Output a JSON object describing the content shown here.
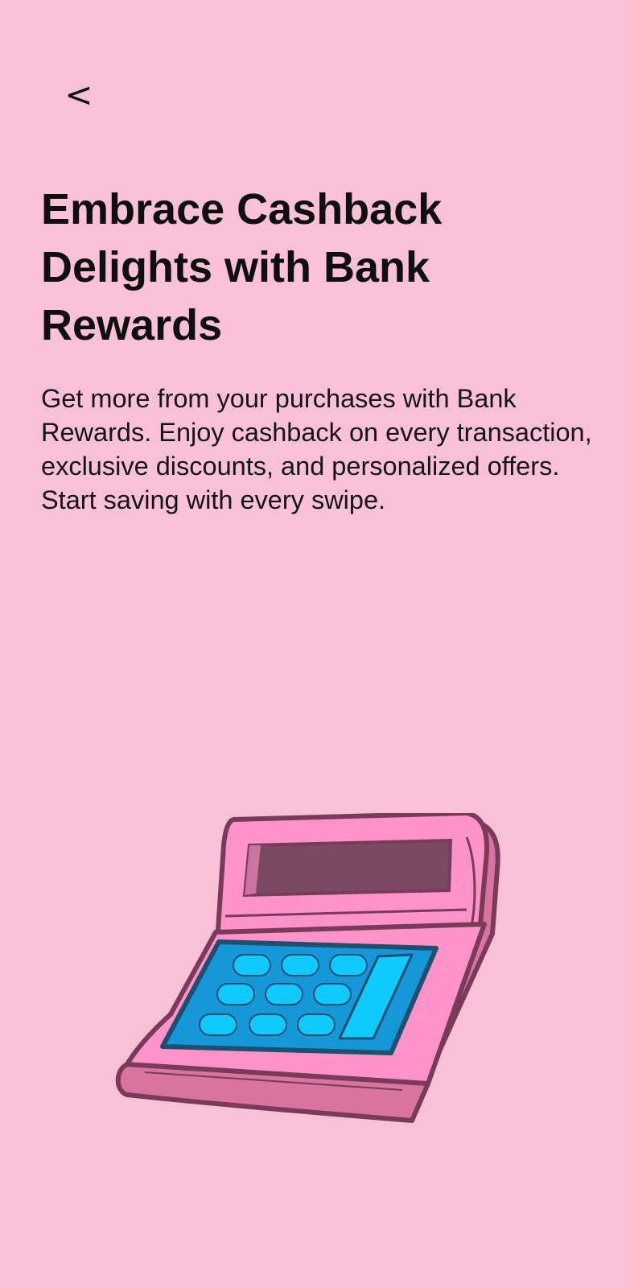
{
  "header": {
    "back_label": "<"
  },
  "content": {
    "title": "Embrace Cashback Delights with Bank Rewards",
    "description": "Get more from your purchases with Bank Rewards. Enjoy cashback on every transaction, exclusive discounts, and personalized offers. Start saving with every swipe."
  },
  "illustration": {
    "icon": "calculator-icon"
  },
  "colors": {
    "background": "#f9c0d7",
    "calculator_body": "#fd93c8",
    "calculator_shade": "#d9739f",
    "calculator_outline": "#7a3a5a",
    "display_screen": "#7a4a63",
    "keypad": "#1698d8",
    "keys": "#10c9ff"
  }
}
